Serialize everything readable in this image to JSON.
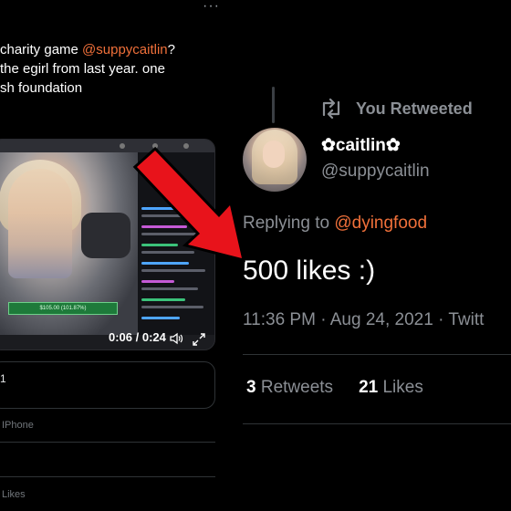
{
  "left_tweet": {
    "more_label": "···",
    "text_line_1_prefix": "charity game ",
    "text_line_1_mention": "@suppycaitlin",
    "text_line_1_suffix": "?",
    "text_line_2": "the egirl from last year. one",
    "text_line_3": "sh foundation",
    "video": {
      "time": "0:06 / 0:24",
      "donation_text": "$105.00 (101.87%)"
    },
    "box_text": "1",
    "device": "IPhone",
    "likes_label": "Likes"
  },
  "retweet": {
    "label": "You Retweeted"
  },
  "main_tweet": {
    "display_name": "✿caitlin✿",
    "handle": "@suppycaitlin",
    "replying_prefix": "Replying to ",
    "replying_mention": "@dyingfood",
    "body": "500 likes :)",
    "timestamp": "11:36 PM · Aug 24, 2021 · Twitt",
    "retweets_count": "3",
    "retweets_label": "Retweets",
    "likes_count": "21",
    "likes_label": "Likes"
  },
  "colors": {
    "background": "#000000",
    "mention": "#f0703a",
    "muted": "#8b8f95",
    "arrow": "#e8131b"
  },
  "icons": {
    "retweet": "retweet-icon",
    "volume": "volume-icon",
    "fullscreen": "fullscreen-icon",
    "arrow": "red-arrow-annotation"
  }
}
